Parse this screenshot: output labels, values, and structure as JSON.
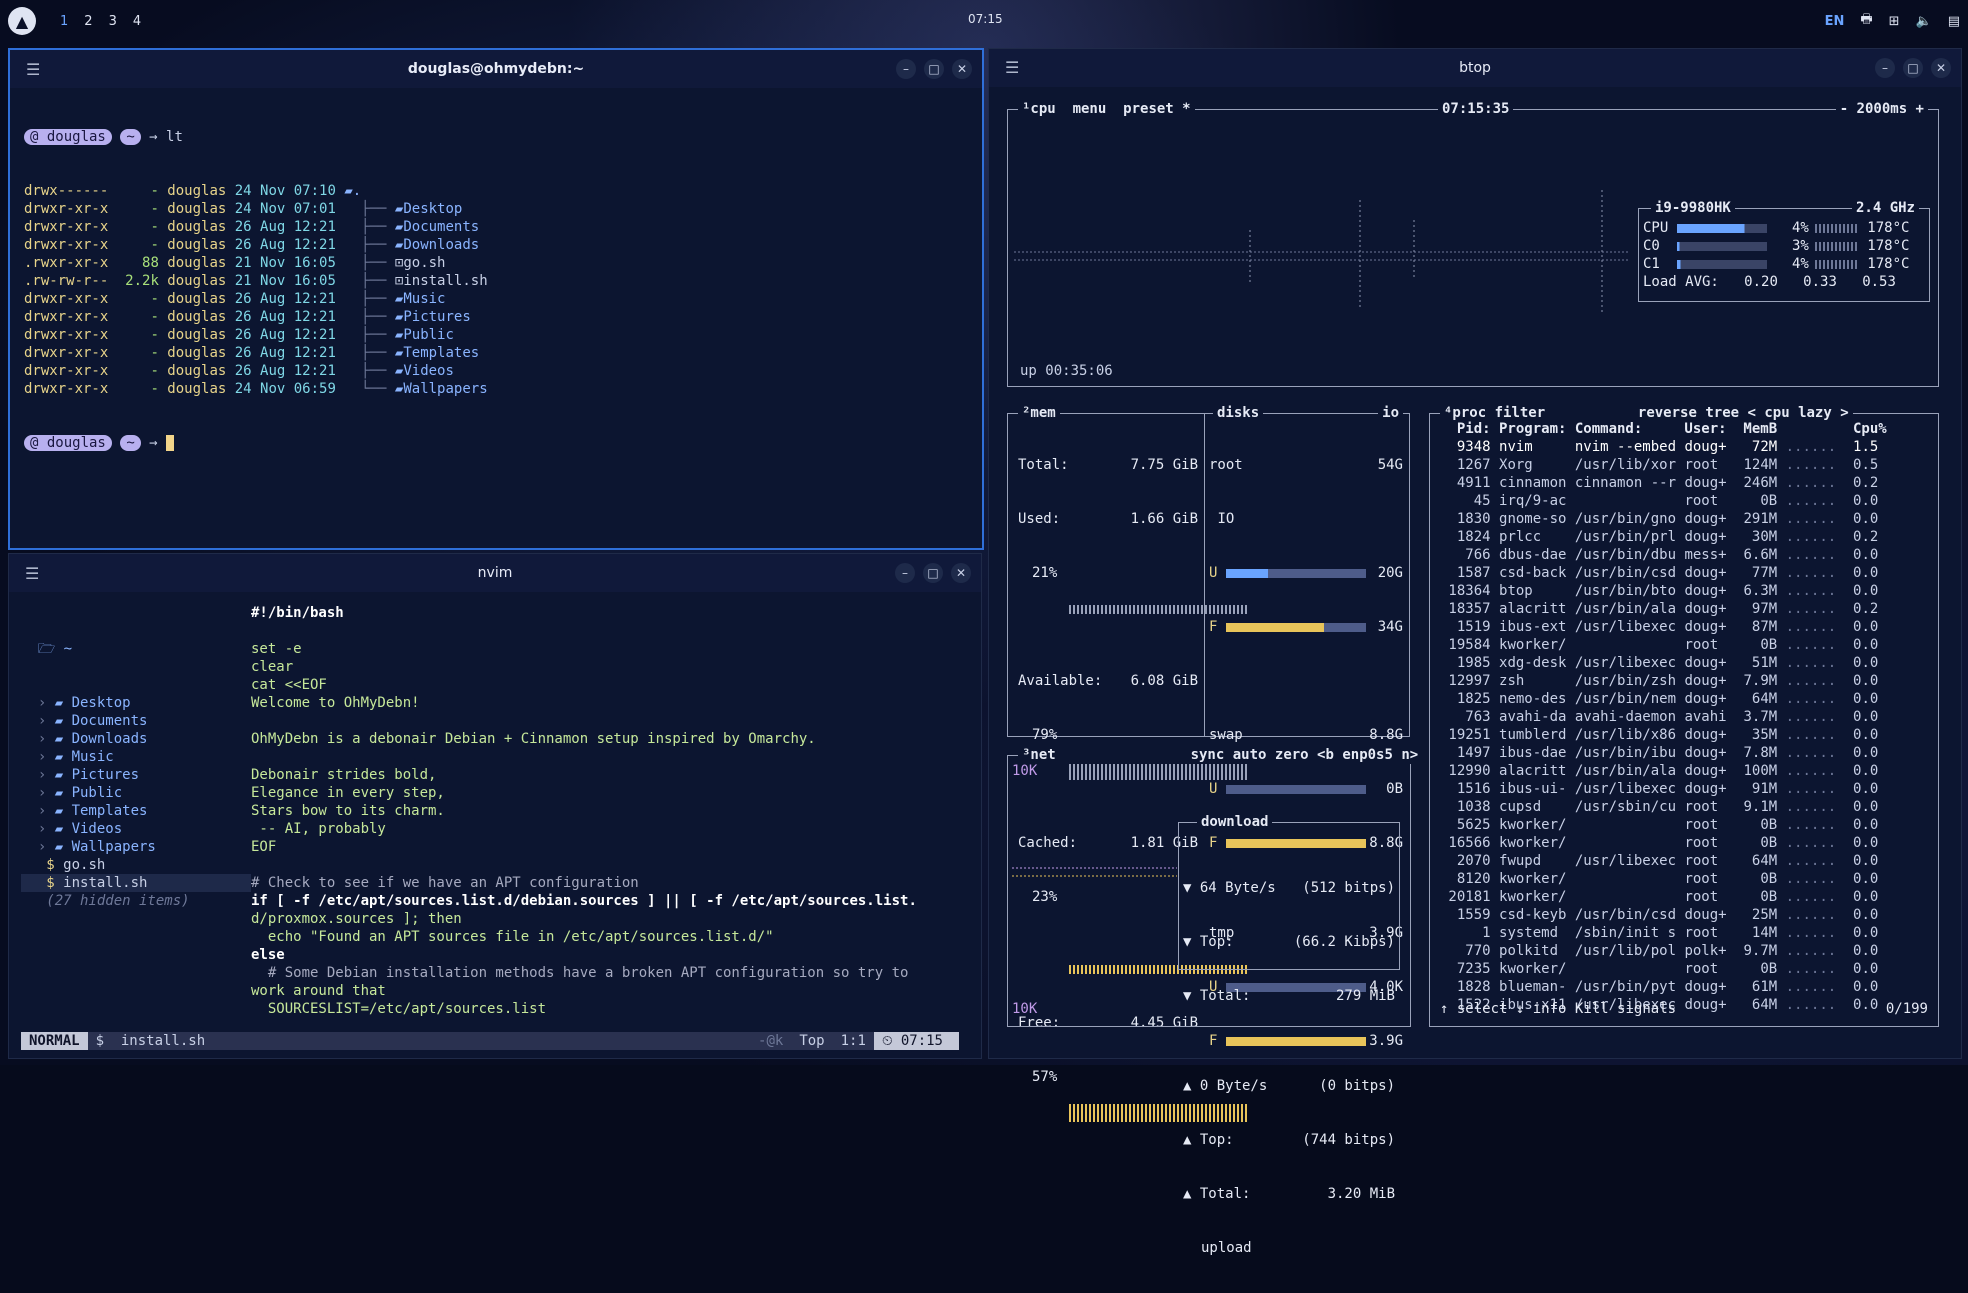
{
  "panel": {
    "workspaces": [
      "1",
      "2",
      "3",
      "4"
    ],
    "clock": "07:15",
    "lang": "EN"
  },
  "term1": {
    "title": "douglas@ohmydebn:~",
    "prompt_user": "douglas",
    "prompt_dir": "~",
    "command": "lt",
    "rows": [
      {
        "perm": "drwx------",
        "size": "-",
        "user": "douglas",
        "date": "24 Nov 07:10",
        "name": "."
      },
      {
        "perm": "drwxr-xr-x",
        "size": "-",
        "user": "douglas",
        "date": "24 Nov 07:01",
        "name": "Desktop"
      },
      {
        "perm": "drwxr-xr-x",
        "size": "-",
        "user": "douglas",
        "date": "26 Aug 12:21",
        "name": "Documents"
      },
      {
        "perm": "drwxr-xr-x",
        "size": "-",
        "user": "douglas",
        "date": "26 Aug 12:21",
        "name": "Downloads"
      },
      {
        "perm": ".rwxr-xr-x",
        "size": "88",
        "user": "douglas",
        "date": "21 Nov 16:05",
        "name": "go.sh"
      },
      {
        "perm": ".rw-rw-r--",
        "size": "2.2k",
        "user": "douglas",
        "date": "21 Nov 16:05",
        "name": "install.sh"
      },
      {
        "perm": "drwxr-xr-x",
        "size": "-",
        "user": "douglas",
        "date": "26 Aug 12:21",
        "name": "Music"
      },
      {
        "perm": "drwxr-xr-x",
        "size": "-",
        "user": "douglas",
        "date": "26 Aug 12:21",
        "name": "Pictures"
      },
      {
        "perm": "drwxr-xr-x",
        "size": "-",
        "user": "douglas",
        "date": "26 Aug 12:21",
        "name": "Public"
      },
      {
        "perm": "drwxr-xr-x",
        "size": "-",
        "user": "douglas",
        "date": "26 Aug 12:21",
        "name": "Templates"
      },
      {
        "perm": "drwxr-xr-x",
        "size": "-",
        "user": "douglas",
        "date": "26 Aug 12:21",
        "name": "Videos"
      },
      {
        "perm": "drwxr-xr-x",
        "size": "-",
        "user": "douglas",
        "date": "24 Nov 06:59",
        "name": "Wallpapers"
      }
    ]
  },
  "nvim": {
    "title": "nvim",
    "tree_root": "~",
    "tree": [
      "Desktop",
      "Documents",
      "Downloads",
      "Music",
      "Pictures",
      "Public",
      "Templates",
      "Videos",
      "Wallpapers"
    ],
    "files": [
      "go.sh",
      "install.sh"
    ],
    "hidden": "(27 hidden items)",
    "lines": [
      "#!/bin/bash",
      "",
      "set -e",
      "clear",
      "cat <<EOF",
      "Welcome to OhMyDebn!",
      "",
      "OhMyDebn is a debonair Debian + Cinnamon setup inspired by Omarchy.",
      "",
      "Debonair strides bold,",
      "Elegance in every step,",
      "Stars bow to its charm.",
      " -- AI, probably",
      "EOF",
      "",
      "# Check to see if we have an APT configuration",
      "if [ -f /etc/apt/sources.list.d/debian.sources ] || [ -f /etc/apt/sources.list.",
      "d/proxmox.sources ]; then",
      "  echo \"Found an APT sources file in /etc/apt/sources.list.d/\"",
      "else",
      "  # Some Debian installation methods have a broken APT configuration so try to",
      "work around that",
      "  SOURCESLIST=/etc/apt/sources.list"
    ],
    "status": {
      "mode": "NORMAL",
      "file": "$  install.sh",
      "pos": "Top",
      "line": "1:1",
      "time": "07:15",
      "flag": "-@k"
    }
  },
  "btop": {
    "title": "btop",
    "cpu_tabs": [
      "¹cpu",
      "menu",
      "preset *"
    ],
    "clock": "07:15:35",
    "interval": "- 2000ms +",
    "cpu_model": "i9-9980HK",
    "cpu_freq": "2.4 GHz",
    "cpu_rows": [
      {
        "name": "CPU",
        "pct": "4%",
        "temp": "178°C",
        "level": 0.75
      },
      {
        "name": "C0",
        "pct": "3%",
        "temp": "178°C",
        "level": 0.03
      },
      {
        "name": "C1",
        "pct": "4%",
        "temp": "178°C",
        "level": 0.04
      }
    ],
    "load_label": "Load AVG:",
    "load": [
      "0.20",
      "0.33",
      "0.53"
    ],
    "uptime": "up 00:35:06",
    "mem": {
      "label": "²mem",
      "total_label": "Total:",
      "total": "7.75 GiB",
      "used_label": "Used:",
      "used": "1.66 GiB",
      "used_pct": "21%",
      "avail_label": "Available:",
      "avail": "6.08 GiB",
      "avail_pct": "79%",
      "cached_label": "Cached:",
      "cached": "1.81 GiB",
      "cached_pct": "23%",
      "free_label": "Free:",
      "free": "4.45 GiB",
      "free_pct": "57%"
    },
    "disks": {
      "label": "disks",
      "io": "io",
      "root": "root",
      "root_size": "54G",
      "root_io": "IO",
      "root_u": "20G",
      "root_f": "34G",
      "swap": "swap",
      "swap_size": "8.8G",
      "swap_u": "0B",
      "swap_f": "8.8G",
      "tmp": "tmp",
      "tmp_size": "3.9G",
      "tmp_u": "4.0K",
      "tmp_f": "3.9G"
    },
    "net": {
      "label": "³net",
      "tabs": [
        "sync",
        "auto",
        "zero",
        "<b enp0s5 n>"
      ],
      "top_scale": "10K",
      "bottom_scale": "10K",
      "download": "download",
      "dl_rate": "64 Byte/s",
      "dl_bits": "(512 bitps)",
      "dl_top_label": "Top:",
      "dl_top": "(66.2 Kibps)",
      "dl_total_label": "Total:",
      "dl_total": "279 MiB",
      "ul_rate": "0 Byte/s",
      "ul_bits": "(0 bitps)",
      "ul_top_label": "Top:",
      "ul_top": "(744 bitps)",
      "ul_total_label": "Total:",
      "ul_total": "3.20 MiB",
      "upload": "upload"
    },
    "proc": {
      "label": "⁴proc",
      "tabs": [
        "filter",
        "reverse",
        "tree",
        "< cpu lazy >"
      ],
      "headers": [
        "Pid:",
        "Program:",
        "Command:",
        "User:",
        "MemB",
        "Cpu%"
      ],
      "rows": [
        [
          "9348",
          "nvim",
          "nvim --embed",
          "doug+",
          "72M",
          "1.5"
        ],
        [
          "1267",
          "Xorg",
          "/usr/lib/xor",
          "root",
          "124M",
          "0.5"
        ],
        [
          "4911",
          "cinnamon",
          "cinnamon --r",
          "doug+",
          "246M",
          "0.2"
        ],
        [
          "45",
          "irq/9-ac",
          "",
          "root",
          "0B",
          "0.0"
        ],
        [
          "1830",
          "gnome-so",
          "/usr/bin/gno",
          "doug+",
          "291M",
          "0.0"
        ],
        [
          "1824",
          "prlcc",
          "/usr/bin/prl",
          "doug+",
          "30M",
          "0.2"
        ],
        [
          "766",
          "dbus-dae",
          "/usr/bin/dbu",
          "mess+",
          "6.6M",
          "0.0"
        ],
        [
          "1587",
          "csd-back",
          "/usr/bin/csd",
          "doug+",
          "77M",
          "0.0"
        ],
        [
          "18364",
          "btop",
          "/usr/bin/bto",
          "doug+",
          "6.3M",
          "0.0"
        ],
        [
          "18357",
          "alacritt",
          "/usr/bin/ala",
          "doug+",
          "97M",
          "0.2"
        ],
        [
          "1519",
          "ibus-ext",
          "/usr/libexec",
          "doug+",
          "87M",
          "0.0"
        ],
        [
          "19584",
          "kworker/",
          "",
          "root",
          "0B",
          "0.0"
        ],
        [
          "1985",
          "xdg-desk",
          "/usr/libexec",
          "doug+",
          "51M",
          "0.0"
        ],
        [
          "12997",
          "zsh",
          "/usr/bin/zsh",
          "doug+",
          "7.9M",
          "0.0"
        ],
        [
          "1825",
          "nemo-des",
          "/usr/bin/nem",
          "doug+",
          "64M",
          "0.0"
        ],
        [
          "763",
          "avahi-da",
          "avahi-daemon",
          "avahi",
          "3.7M",
          "0.0"
        ],
        [
          "19251",
          "tumblerd",
          "/usr/lib/x86",
          "doug+",
          "35M",
          "0.0"
        ],
        [
          "1497",
          "ibus-dae",
          "/usr/bin/ibu",
          "doug+",
          "7.8M",
          "0.0"
        ],
        [
          "12990",
          "alacritt",
          "/usr/bin/ala",
          "doug+",
          "100M",
          "0.0"
        ],
        [
          "1516",
          "ibus-ui-",
          "/usr/libexec",
          "doug+",
          "91M",
          "0.0"
        ],
        [
          "1038",
          "cupsd",
          "/usr/sbin/cu",
          "root",
          "9.1M",
          "0.0"
        ],
        [
          "5625",
          "kworker/",
          "",
          "root",
          "0B",
          "0.0"
        ],
        [
          "16566",
          "kworker/",
          "",
          "root",
          "0B",
          "0.0"
        ],
        [
          "2070",
          "fwupd",
          "/usr/libexec",
          "root",
          "64M",
          "0.0"
        ],
        [
          "8120",
          "kworker/",
          "",
          "root",
          "0B",
          "0.0"
        ],
        [
          "20181",
          "kworker/",
          "",
          "root",
          "0B",
          "0.0"
        ],
        [
          "1559",
          "csd-keyb",
          "/usr/bin/csd",
          "doug+",
          "25M",
          "0.0"
        ],
        [
          "1",
          "systemd",
          "/sbin/init s",
          "root",
          "14M",
          "0.0"
        ],
        [
          "770",
          "polkitd",
          "/usr/lib/pol",
          "polk+",
          "9.7M",
          "0.0"
        ],
        [
          "7235",
          "kworker/",
          "",
          "root",
          "0B",
          "0.0"
        ],
        [
          "1828",
          "blueman-",
          "/usr/bin/pyt",
          "doug+",
          "61M",
          "0.0"
        ],
        [
          "1522",
          "ibus-x11",
          "/usr/libexec",
          "doug+",
          "64M",
          "0.0"
        ]
      ],
      "footer": [
        "↑ select ↓",
        "info",
        "Kill",
        "signals"
      ],
      "count": "0/199"
    }
  }
}
